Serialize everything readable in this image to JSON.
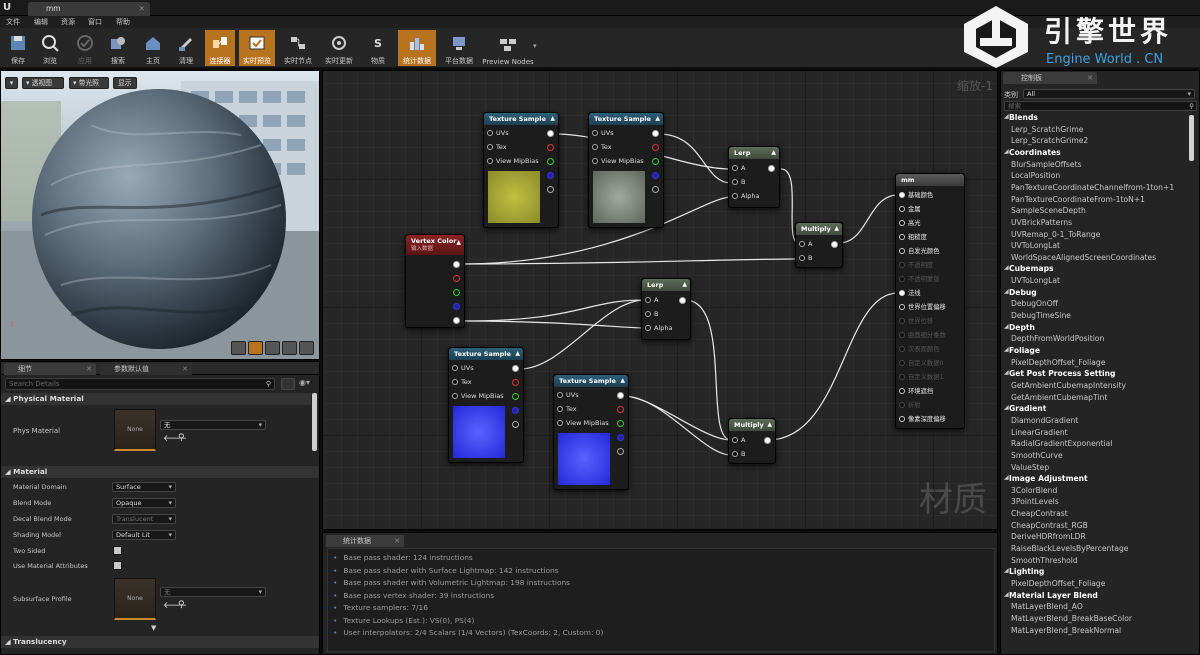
{
  "tab_title": "mm",
  "menu": [
    "文件",
    "编辑",
    "资源",
    "窗口",
    "帮助"
  ],
  "toolbar": [
    {
      "label": "保存",
      "icon": "save-icon",
      "active": false
    },
    {
      "label": "浏览",
      "icon": "browse-icon",
      "active": false
    },
    {
      "label": "应用",
      "icon": "apply-icon",
      "active": false
    },
    {
      "label": "搜索",
      "icon": "search-icon",
      "active": false
    },
    {
      "label": "主页",
      "icon": "home-icon",
      "active": false
    },
    {
      "label": "清理",
      "icon": "clean-icon",
      "active": false
    },
    {
      "label": "连接器",
      "icon": "connector-icon",
      "active": true
    },
    {
      "label": "实时预览",
      "icon": "live-preview-icon",
      "active": true
    },
    {
      "label": "实时节点",
      "icon": "live-nodes-icon",
      "active": false
    },
    {
      "label": "实时更新",
      "icon": "live-update-icon",
      "active": false
    },
    {
      "label": "物质",
      "icon": "substance-icon",
      "active": false
    },
    {
      "label": "统计数据",
      "icon": "stats-icon",
      "active": true
    },
    {
      "label": "平台数据",
      "icon": "platform-stats-icon",
      "active": false
    },
    {
      "label": "Preview Nodes",
      "icon": "preview-nodes-icon",
      "active": false
    }
  ],
  "watermark": {
    "title": "引擎世界",
    "subtitle": "Engine World . CN"
  },
  "viewport": {
    "buttons": [
      "透视图",
      "带光照",
      "显示"
    ]
  },
  "graph": {
    "zoom_label": "缩放-1",
    "watermark": "材质"
  },
  "nodes": {
    "tex1": {
      "title": "Texture Sample",
      "pins": [
        "UVs",
        "Tex",
        "View MipBias"
      ]
    },
    "tex2": {
      "title": "Texture Sample",
      "pins": [
        "UVs",
        "Tex",
        "View MipBias"
      ]
    },
    "tex3": {
      "title": "Texture Sample",
      "pins": [
        "UVs",
        "Tex",
        "View MipBias"
      ]
    },
    "tex4": {
      "title": "Texture Sample",
      "pins": [
        "UVs",
        "Tex",
        "View MipBias"
      ]
    },
    "vcolor": {
      "title": "Vertex Color",
      "subtitle": "输入数据"
    },
    "lerp1": {
      "title": "Lerp",
      "pins": [
        "A",
        "B",
        "Alpha"
      ]
    },
    "lerp2": {
      "title": "Lerp",
      "pins": [
        "A",
        "B",
        "Alpha"
      ]
    },
    "mult1": {
      "title": "Multiply",
      "pins": [
        "A",
        "B"
      ]
    },
    "mult2": {
      "title": "Multiply",
      "pins": [
        "A",
        "B"
      ]
    },
    "result": {
      "title": "mm",
      "pins": [
        {
          "label": "基础颜色",
          "enabled": true
        },
        {
          "label": "金属",
          "enabled": true
        },
        {
          "label": "高光",
          "enabled": true
        },
        {
          "label": "粗糙度",
          "enabled": true
        },
        {
          "label": "自发光颜色",
          "enabled": true
        },
        {
          "label": "不透明度",
          "enabled": false
        },
        {
          "label": "不透明蒙版",
          "enabled": false
        },
        {
          "label": "法线",
          "enabled": true
        },
        {
          "label": "世界位置偏移",
          "enabled": true
        },
        {
          "label": "世界位移",
          "enabled": false
        },
        {
          "label": "曲面细分乘数",
          "enabled": false
        },
        {
          "label": "次表面颜色",
          "enabled": false
        },
        {
          "label": "自定义数据0",
          "enabled": false
        },
        {
          "label": "自定义数据1",
          "enabled": false
        },
        {
          "label": "环境遮挡",
          "enabled": true
        },
        {
          "label": "折射",
          "enabled": false
        },
        {
          "label": "像素深度偏移",
          "enabled": true
        }
      ]
    }
  },
  "details": {
    "tabs": [
      "细节",
      "参数默认值"
    ],
    "search_placeholder": "Search Details",
    "physical_section": "Physical Material",
    "phys_label": "Phys Material",
    "phys_value": "无",
    "thumb_none": "None",
    "material_section": "Material",
    "props": [
      {
        "label": "Material Domain",
        "value": "Surface",
        "type": "select",
        "enabled": true
      },
      {
        "label": "Blend Mode",
        "value": "Opaque",
        "type": "select",
        "enabled": true
      },
      {
        "label": "Decal Blend Mode",
        "value": "Translucent",
        "type": "select",
        "enabled": false
      },
      {
        "label": "Shading Model",
        "value": "Default Lit",
        "type": "select",
        "enabled": true
      },
      {
        "label": "Two Sided",
        "value": "",
        "type": "check",
        "enabled": true
      },
      {
        "label": "Use Material Attributes",
        "value": "",
        "type": "check",
        "enabled": true
      }
    ],
    "subsurface_label": "Subsurface Profile",
    "subsurface_value": "无",
    "translucency_section": "Translucency"
  },
  "stats": {
    "tab": "统计数据",
    "lines": [
      "Base pass shader: 124 instructions",
      "Base pass shader with Surface Lightmap: 142 instructions",
      "Base pass shader with Volumetric Lightmap: 198 instructions",
      "Base pass vertex shader: 39 instructions",
      "Texture samplers: 7/16",
      "Texture Lookups (Est.): VS(0), PS(4)",
      "User interpolators: 2/4 Scalars (1/4 Vectors) (TexCoords: 2, Custom: 0)"
    ]
  },
  "palette": {
    "tab": "控制板",
    "category_label": "类别",
    "category_value": "All",
    "search_placeholder": "搜索",
    "groups": [
      {
        "name": "Blends",
        "items": [
          "Lerp_ScratchGrime",
          "Lerp_ScratchGrime2"
        ]
      },
      {
        "name": "Coordinates",
        "items": [
          "BlurSampleOffsets",
          "LocalPosition",
          "PanTextureCoordinateChannelfrom-1ton+1",
          "PanTextureCoordinateFrom-1toN+1",
          "SampleSceneDepth",
          "UVBrickPatterns",
          "UVRemap_0-1_ToRange",
          "UVToLongLat",
          "WorldSpaceAlignedScreenCoordinates"
        ]
      },
      {
        "name": "Cubemaps",
        "items": [
          "UVToLongLat"
        ]
      },
      {
        "name": "Debug",
        "items": [
          "DebugOnOff",
          "DebugTimeSine"
        ]
      },
      {
        "name": "Depth",
        "items": [
          "DepthFromWorldPosition"
        ]
      },
      {
        "name": "Foliage",
        "items": [
          "PixelDepthOffset_Foliage"
        ]
      },
      {
        "name": "Get Post Process Setting",
        "items": [
          "GetAmbientCubemapIntensity",
          "GetAmbientCubemapTint"
        ]
      },
      {
        "name": "Gradient",
        "items": [
          "DiamondGradient",
          "LinearGradient",
          "RadialGradientExponential",
          "SmoothCurve",
          "ValueStep"
        ]
      },
      {
        "name": "Image Adjustment",
        "items": [
          "3ColorBlend",
          "3PointLevels",
          "CheapContrast",
          "CheapContrast_RGB",
          "DeriveHDRfromLDR",
          "RaiseBlackLevelsByPercentage",
          "SmoothThreshold"
        ]
      },
      {
        "name": "Lighting",
        "items": [
          "PixelDepthOffset_Foliage"
        ]
      },
      {
        "name": "Material Layer Blend",
        "items": [
          "MatLayerBlend_AO",
          "MatLayerBlend_BreakBaseColor",
          "MatLayerBlend_BreakNormal"
        ]
      }
    ]
  },
  "colors": {
    "accent": "#b8731f",
    "node_tex": "#2d5f7a",
    "node_vc": "#8a2424",
    "stat_bullet": "#4f8dd6"
  }
}
